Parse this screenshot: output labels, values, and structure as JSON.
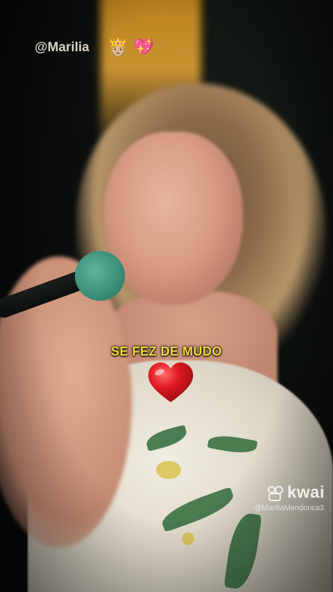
{
  "overlay": {
    "handle": "@Marilia",
    "handle_emojis": [
      "👸🏼",
      "💖"
    ],
    "caption": "SE FEZ DE MUDO",
    "caption_color": "#f3dd3d",
    "heart_color": "#e01822"
  },
  "watermark": {
    "brand": "kwai",
    "username": "@MariliaMendonca3"
  }
}
